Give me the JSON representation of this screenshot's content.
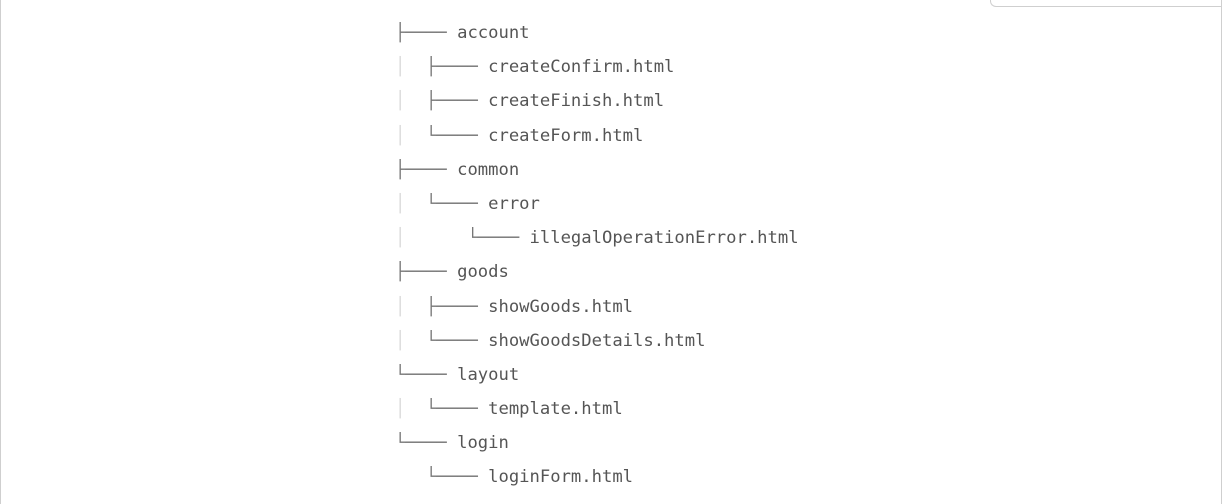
{
  "tree": {
    "lines": [
      {
        "prefix": "",
        "connector": "├──── ",
        "name": "account"
      },
      {
        "prefix": "│  ",
        "connector": "├──── ",
        "name": "createConfirm.html"
      },
      {
        "prefix": "│  ",
        "connector": "├──── ",
        "name": "createFinish.html"
      },
      {
        "prefix": "│  ",
        "connector": "└──── ",
        "name": "createForm.html"
      },
      {
        "prefix": "",
        "connector": "├──── ",
        "name": "common"
      },
      {
        "prefix": "│  ",
        "connector": "└──── ",
        "name": "error"
      },
      {
        "prefix": "│      ",
        "connector": "└──── ",
        "name": "illegalOperationError.html"
      },
      {
        "prefix": "",
        "connector": "├──── ",
        "name": "goods"
      },
      {
        "prefix": "│  ",
        "connector": "├──── ",
        "name": "showGoods.html"
      },
      {
        "prefix": "│  ",
        "connector": "└──── ",
        "name": "showGoodsDetails.html"
      },
      {
        "prefix": "",
        "connector": "└──── ",
        "name": "layout"
      },
      {
        "prefix": "│  ",
        "connector": "└──── ",
        "name": "template.html"
      },
      {
        "prefix": "",
        "connector": "└──── ",
        "name": "login"
      },
      {
        "prefix": "   ",
        "connector": "└──── ",
        "name": "loginForm.html"
      }
    ]
  }
}
